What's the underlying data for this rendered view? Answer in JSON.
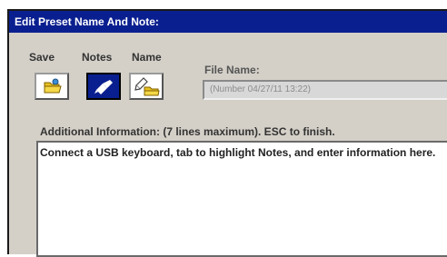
{
  "dialog": {
    "title": "Edit Preset Name And Note:"
  },
  "toolbar": {
    "save_label": "Save",
    "notes_label": "Notes",
    "name_label": "Name"
  },
  "file": {
    "label": "File Name:",
    "value": "(Number 04/27/11 13:22)"
  },
  "info": {
    "label": "Additional Information: (7 lines maximum). ESC to finish.",
    "text": "Connect a USB keyboard, tab to highlight Notes, and enter information here."
  },
  "colors": {
    "title_bar": "#0a1f8f",
    "selected_button": "#0a1f8f",
    "dialog_background": "#d4d0c8"
  },
  "icons": {
    "save": "folder-icon",
    "notes": "note-pen-icon",
    "name": "pencil-folder-icon"
  }
}
